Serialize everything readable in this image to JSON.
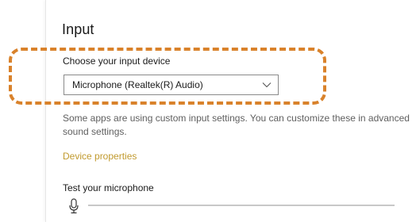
{
  "input_section": {
    "title": "Input",
    "device_label": "Choose your input device",
    "device_select": {
      "selected": "Microphone (Realtek(R) Audio)"
    },
    "info_text": "Some apps are using custom input settings. You can customize these in advanced sound settings.",
    "device_properties_link": "Device properties",
    "test_label": "Test your microphone",
    "mic_level": 0
  },
  "colors": {
    "highlight": "#d9822b",
    "link": "#c19a2e"
  },
  "icons": {
    "dropdown": "chevron-down-icon",
    "microphone": "microphone-icon"
  }
}
